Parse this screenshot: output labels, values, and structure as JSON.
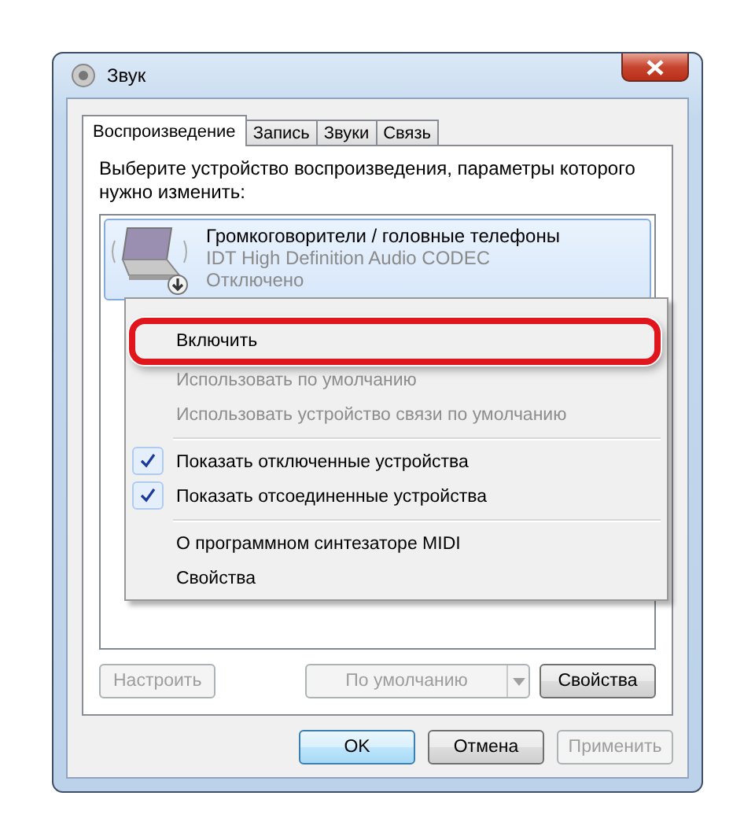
{
  "window": {
    "title": "Звук"
  },
  "tabs": [
    {
      "label": "Воспроизведение",
      "selected": true
    },
    {
      "label": "Запись",
      "selected": false
    },
    {
      "label": "Звуки",
      "selected": false
    },
    {
      "label": "Связь",
      "selected": false
    }
  ],
  "instruction": "Выберите устройство воспроизведения, параметры которого нужно изменить:",
  "devices": [
    {
      "name": "Громкоговорители / головные телефоны",
      "driver": "IDT High Definition Audio CODEC",
      "status": "Отключено",
      "selected": true
    }
  ],
  "context_menu": [
    {
      "kind": "hidden"
    },
    {
      "kind": "item",
      "label": "Включить",
      "disabled": false,
      "checked": false,
      "highlighted": true
    },
    {
      "kind": "item",
      "label": "Использовать по умолчанию",
      "disabled": true,
      "checked": false,
      "highlighted": false
    },
    {
      "kind": "item",
      "label": "Использовать устройство связи по умолчанию",
      "disabled": true,
      "checked": false,
      "highlighted": false
    },
    {
      "kind": "separator"
    },
    {
      "kind": "item",
      "label": "Показать отключенные устройства",
      "disabled": false,
      "checked": true,
      "highlighted": false
    },
    {
      "kind": "item",
      "label": "Показать отсоединенные устройства",
      "disabled": false,
      "checked": true,
      "highlighted": false
    },
    {
      "kind": "separator"
    },
    {
      "kind": "item",
      "label": "О программном синтезаторе MIDI",
      "disabled": false,
      "checked": false,
      "highlighted": false
    },
    {
      "kind": "item",
      "label": "Свойства",
      "disabled": false,
      "checked": false,
      "highlighted": false
    }
  ],
  "panel_buttons": [
    {
      "kind": "button",
      "label": "Настроить",
      "disabled": true
    },
    {
      "kind": "split",
      "label": "По умолчанию",
      "disabled": true
    },
    {
      "kind": "button",
      "label": "Свойства",
      "disabled": false
    }
  ],
  "dialog_buttons": [
    {
      "label": "OK",
      "disabled": false,
      "default": true
    },
    {
      "label": "Отмена",
      "disabled": false,
      "default": false
    },
    {
      "label": "Применить",
      "disabled": true,
      "default": false
    }
  ]
}
